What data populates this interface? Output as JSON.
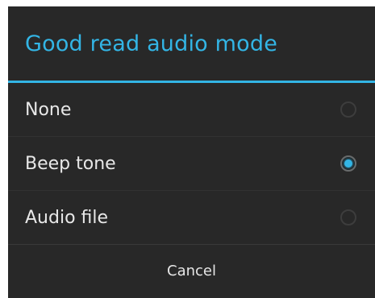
{
  "dialog": {
    "title": "Good read audio mode",
    "options": [
      {
        "label": "None",
        "selected": false
      },
      {
        "label": "Beep tone",
        "selected": true
      },
      {
        "label": "Audio file",
        "selected": false
      }
    ],
    "cancel_label": "Cancel"
  },
  "colors": {
    "accent": "#33b5e5",
    "background": "#282828"
  }
}
